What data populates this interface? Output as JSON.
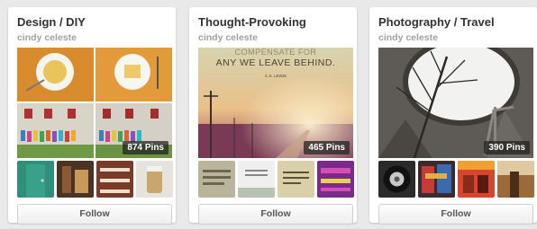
{
  "boards": [
    {
      "title": "Design / DIY",
      "owner": "cindy celeste",
      "pin_count": "874 Pins",
      "follow_label": "Follow"
    },
    {
      "title": "Thought-Provoking",
      "owner": "cindy celeste",
      "pin_count": "465 Pins",
      "follow_label": "Follow",
      "cover_quote_line1": "ANY WE LEAVE BEHIND.",
      "cover_quote_author": "C.S. LEWIS"
    },
    {
      "title": "Photography / Travel",
      "owner": "cindy celeste",
      "pin_count": "390 Pins",
      "follow_label": "Follow"
    }
  ]
}
